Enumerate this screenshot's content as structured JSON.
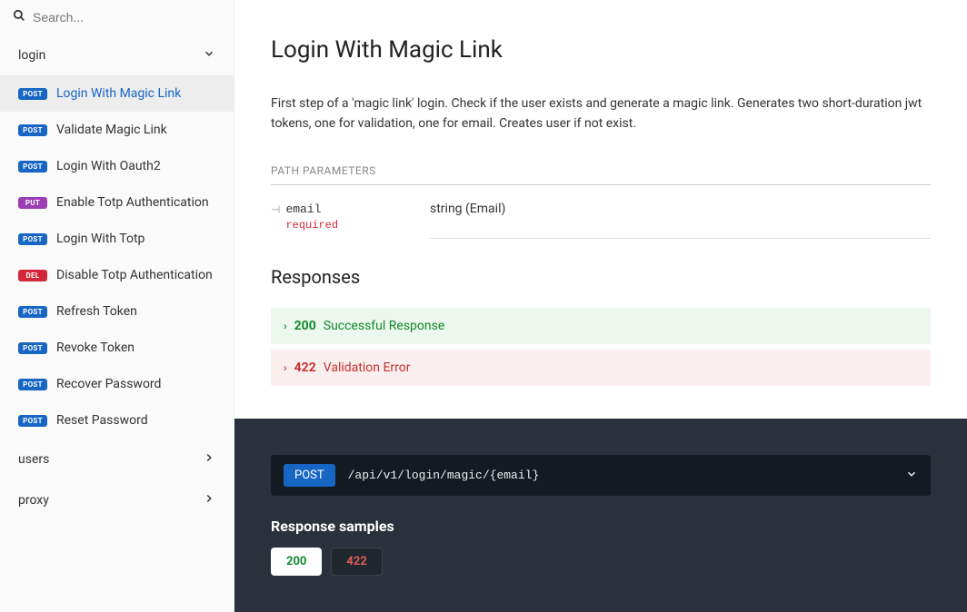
{
  "search": {
    "placeholder": "Search..."
  },
  "sidebar": {
    "groups": [
      {
        "name": "login",
        "expanded": true,
        "items": [
          {
            "method": "POST",
            "methodClass": "method-post",
            "label": "Login With Magic Link",
            "active": true
          },
          {
            "method": "POST",
            "methodClass": "method-post",
            "label": "Validate Magic Link"
          },
          {
            "method": "POST",
            "methodClass": "method-post",
            "label": "Login With Oauth2"
          },
          {
            "method": "PUT",
            "methodClass": "method-put",
            "label": "Enable Totp Authentication"
          },
          {
            "method": "POST",
            "methodClass": "method-post",
            "label": "Login With Totp"
          },
          {
            "method": "DEL",
            "methodClass": "method-del",
            "label": "Disable Totp Authentication"
          },
          {
            "method": "POST",
            "methodClass": "method-post",
            "label": "Refresh Token"
          },
          {
            "method": "POST",
            "methodClass": "method-post",
            "label": "Revoke Token"
          },
          {
            "method": "POST",
            "methodClass": "method-post",
            "label": "Recover Password"
          },
          {
            "method": "POST",
            "methodClass": "method-post",
            "label": "Reset Password"
          }
        ]
      },
      {
        "name": "users",
        "expanded": false
      },
      {
        "name": "proxy",
        "expanded": false
      }
    ]
  },
  "page": {
    "title": "Login With Magic Link",
    "description": "First step of a 'magic link' login. Check if the user exists and generate a magic link. Generates two short-duration jwt tokens, one for validation, one for email. Creates user if not exist.",
    "pathParamsLabel": "PATH PARAMETERS",
    "params": [
      {
        "name": "email",
        "required": "required",
        "type": "string (Email)"
      }
    ],
    "responsesTitle": "Responses",
    "responses": [
      {
        "code": "200",
        "text": "Successful Response",
        "cls": "resp-200"
      },
      {
        "code": "422",
        "text": "Validation Error",
        "cls": "resp-422"
      }
    ]
  },
  "samples": {
    "method": "POST",
    "path": "/api/v1/login/magic/{email}",
    "title": "Response samples",
    "tabs": [
      {
        "label": "200",
        "cls": "tab-200"
      },
      {
        "label": "422",
        "cls": "tab-422"
      }
    ]
  }
}
